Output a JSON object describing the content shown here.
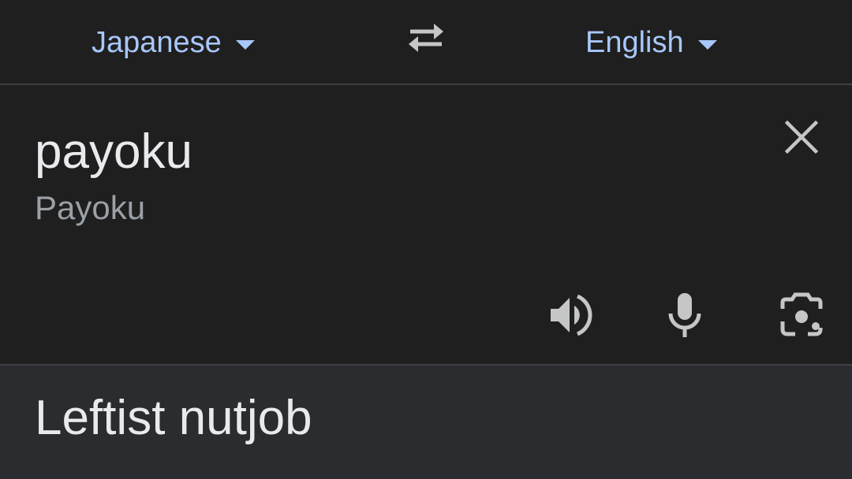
{
  "languages": {
    "source": "Japanese",
    "target": "English"
  },
  "input": {
    "text": "payoku",
    "transliteration": "Payoku"
  },
  "output": {
    "text": "Leftist nutjob"
  },
  "icons": {
    "swap": "swap-arrows-icon",
    "clear": "close-icon",
    "speaker": "speaker-icon",
    "mic": "microphone-icon",
    "camera": "camera-lens-icon"
  },
  "colors": {
    "background": "#1f1f1f",
    "output_background": "#2b2c2f",
    "accent": "#a8c7fa",
    "text_primary": "#e8eaed",
    "text_secondary": "#9aa0a6",
    "icon": "#c4c7c5",
    "divider": "#3f4042"
  }
}
